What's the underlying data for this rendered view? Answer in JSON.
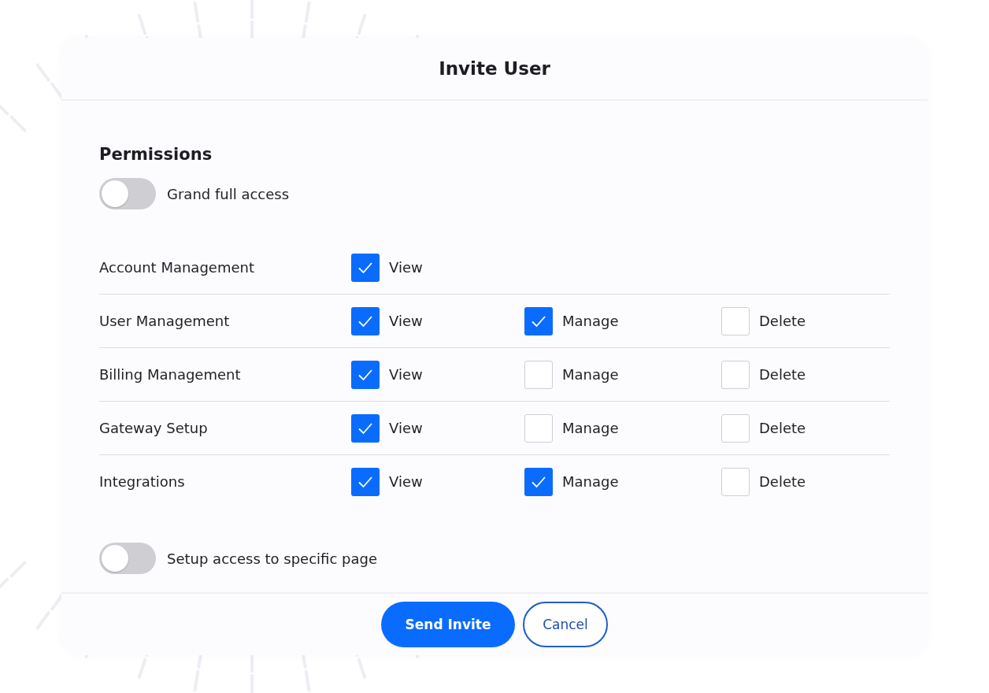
{
  "dialog": {
    "title": "Invite User"
  },
  "section_title": "Permissions",
  "full_access": {
    "label": "Grand full access",
    "on": false
  },
  "rows": [
    {
      "name": "Account Management",
      "permissions": [
        {
          "label": "View",
          "checked": true
        }
      ]
    },
    {
      "name": "User Management",
      "permissions": [
        {
          "label": "View",
          "checked": true
        },
        {
          "label": "Manage",
          "checked": true
        },
        {
          "label": "Delete",
          "checked": false
        }
      ]
    },
    {
      "name": "Billing Management",
      "permissions": [
        {
          "label": "View",
          "checked": true
        },
        {
          "label": "Manage",
          "checked": false
        },
        {
          "label": "Delete",
          "checked": false
        }
      ]
    },
    {
      "name": "Gateway Setup",
      "permissions": [
        {
          "label": "View",
          "checked": true
        },
        {
          "label": "Manage",
          "checked": false
        },
        {
          "label": "Delete",
          "checked": false
        }
      ]
    },
    {
      "name": "Integrations",
      "permissions": [
        {
          "label": "View",
          "checked": true
        },
        {
          "label": "Manage",
          "checked": true
        },
        {
          "label": "Delete",
          "checked": false
        }
      ]
    }
  ],
  "specific_page": {
    "label": "Setup access to specific page",
    "on": false
  },
  "buttons": [
    {
      "label": "Send Invite",
      "kind": "primary"
    },
    {
      "label": "Cancel",
      "kind": "secondary"
    }
  ]
}
